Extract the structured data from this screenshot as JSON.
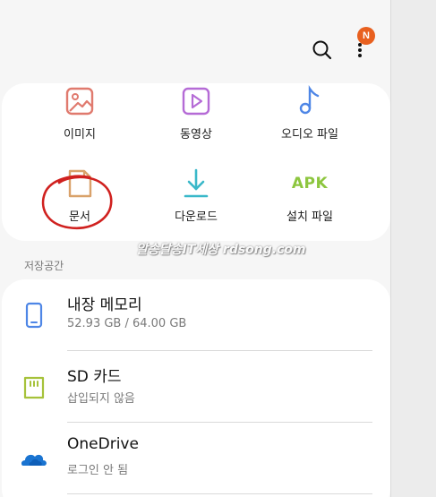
{
  "header": {
    "notification_badge": "N",
    "badge_color": "#e8601f"
  },
  "categories": [
    {
      "label": "이미지",
      "icon": "image-icon",
      "color": "#e07a6e"
    },
    {
      "label": "동영상",
      "icon": "video-icon",
      "color": "#b56bd6"
    },
    {
      "label": "오디오 파일",
      "icon": "audio-icon",
      "color": "#4e86e6"
    },
    {
      "label": "문서",
      "icon": "document-icon",
      "color": "#d9a26a"
    },
    {
      "label": "다운로드",
      "icon": "download-icon",
      "color": "#39b8c9"
    },
    {
      "label": "설치 파일",
      "icon": "apk-icon",
      "icon_text": "APK",
      "color": "#8dc63f"
    }
  ],
  "watermark": "알송달송IT세상 rdsong.com",
  "storage": {
    "section_title": "저장공간",
    "items": [
      {
        "name": "내장 메모리",
        "detail": "52.93 GB / 64.00 GB",
        "icon": "phone-icon",
        "color": "#4e86e6"
      },
      {
        "name": "SD 카드",
        "detail": "삽입되지 않음",
        "icon": "sd-card-icon",
        "color": "#a6c23a"
      },
      {
        "name": "OneDrive",
        "detail": "로그인 안 됨",
        "icon": "onedrive-icon",
        "color": "#1a74d1"
      }
    ]
  }
}
